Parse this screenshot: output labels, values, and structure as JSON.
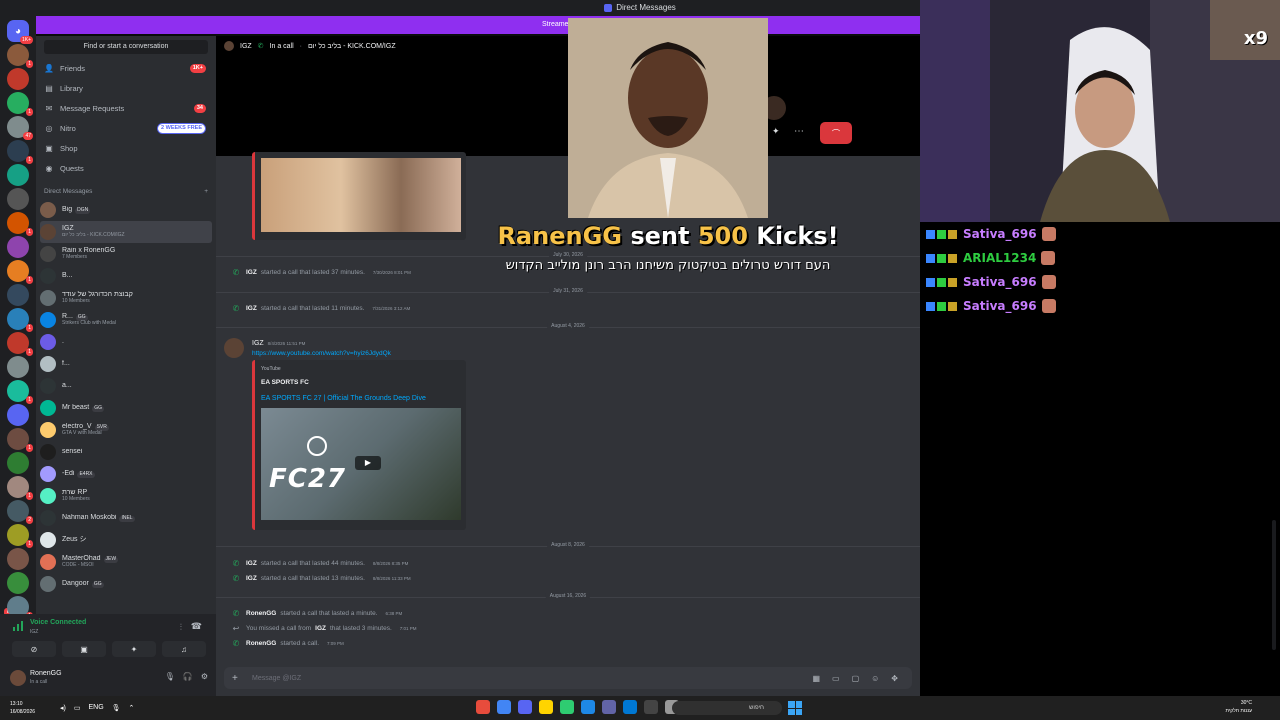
{
  "window": {
    "title": "Direct Messages"
  },
  "stream_banner": "Streame",
  "rail": {
    "new_label": "NEW",
    "servers": [
      {
        "color": "#5865f2",
        "badge": "1K+"
      },
      {
        "color": "#8b5a3c",
        "badge": "1"
      },
      {
        "color": "#c0392b",
        "badge": ""
      },
      {
        "color": "#27ae60",
        "badge": "1"
      },
      {
        "color": "#7f8c8d",
        "badge": "47"
      },
      {
        "color": "#2c3e50",
        "badge": "1"
      },
      {
        "color": "#16a085",
        "badge": ""
      },
      {
        "color": "#555",
        "badge": ""
      },
      {
        "color": "#d35400",
        "badge": "1"
      },
      {
        "color": "#8e44ad",
        "badge": ""
      },
      {
        "color": "#e67e22",
        "badge": "1"
      },
      {
        "color": "#34495e",
        "badge": ""
      },
      {
        "color": "#2980b9",
        "badge": "1"
      },
      {
        "color": "#c0392b",
        "badge": "1"
      },
      {
        "color": "#7f8c8d",
        "badge": ""
      },
      {
        "color": "#1abc9c",
        "badge": "1"
      },
      {
        "color": "#5865f2",
        "badge": ""
      },
      {
        "color": "#6d4c41",
        "badge": "1"
      },
      {
        "color": "#2e7d32",
        "badge": ""
      },
      {
        "color": "#a1887f",
        "badge": "1"
      },
      {
        "color": "#455a64",
        "badge": "2"
      },
      {
        "color": "#9e9d24",
        "badge": "1"
      },
      {
        "color": "#795548",
        "badge": ""
      },
      {
        "color": "#388e3c",
        "badge": ""
      },
      {
        "color": "#607d8b",
        "badge": "1"
      }
    ]
  },
  "sidebar": {
    "search_placeholder": "Find or start a conversation",
    "nav": [
      {
        "label": "Friends",
        "icon": "friends-icon",
        "glyph": "👤",
        "badge": "1K+",
        "promo": false
      },
      {
        "label": "Library",
        "icon": "library-icon",
        "glyph": "▤",
        "badge": "",
        "promo": false
      },
      {
        "label": "Message Requests",
        "icon": "mail-icon",
        "glyph": "✉",
        "badge": "34",
        "promo": false
      },
      {
        "label": "Nitro",
        "icon": "nitro-icon",
        "glyph": "◎",
        "badge": "2 WEEKS FREE",
        "promo": true
      },
      {
        "label": "Shop",
        "icon": "shop-icon",
        "glyph": "▣",
        "badge": "",
        "promo": false
      },
      {
        "label": "Quests",
        "icon": "quests-icon",
        "glyph": "◉",
        "badge": "",
        "promo": false
      }
    ],
    "dm_header": "Direct Messages",
    "dm_add": "+",
    "dms": [
      {
        "name": "Big",
        "tag": "DGN",
        "sub": "",
        "color": "#7a5c4a",
        "active": false
      },
      {
        "name": "IGZ",
        "tag": "",
        "sub": "בליב כל יום - KICK.COM/IGZ",
        "color": "#5b4335",
        "active": true
      },
      {
        "name": "Rain x RonenGG",
        "tag": "",
        "sub": "7 Members",
        "color": "#444",
        "active": false
      },
      {
        "name": "B...",
        "tag": "",
        "sub": "",
        "color": "#2d3436",
        "active": false
      },
      {
        "name": "קבוצת הכדורגל של עודד",
        "tag": "",
        "sub": "10 Members",
        "color": "#636e72",
        "active": false
      },
      {
        "name": "R...",
        "tag": "GG",
        "sub": "Strikers Club with Medal",
        "color": "#0984e3",
        "active": false
      },
      {
        "name": ".",
        "tag": "",
        "sub": "",
        "color": "#6c5ce7",
        "active": false
      },
      {
        "name": "f...",
        "tag": "",
        "sub": "",
        "color": "#b2bec3",
        "active": false
      },
      {
        "name": "a...",
        "tag": "",
        "sub": "",
        "color": "#2d3436",
        "active": false
      },
      {
        "name": "Mr beast",
        "tag": "GG",
        "sub": "",
        "color": "#00b894",
        "active": false
      },
      {
        "name": "electro_V",
        "tag": "SVR",
        "sub": "GTA V with Medal",
        "color": "#fdcb6e",
        "active": false
      },
      {
        "name": "sensei",
        "tag": "",
        "sub": "",
        "color": "#1e1e1e",
        "active": false
      },
      {
        "name": "-Edi",
        "tag": "E4RX",
        "sub": "",
        "color": "#a29bfe",
        "active": false
      },
      {
        "name": "שרת RP",
        "tag": "",
        "sub": "10 Members",
        "color": "#55efc4",
        "active": false
      },
      {
        "name": "Nahman Moskobi",
        "tag": "INEL",
        "sub": "",
        "color": "#2d3436",
        "active": false
      },
      {
        "name": "Zeus シ",
        "tag": "",
        "sub": "",
        "color": "#dfe6e9",
        "active": false
      },
      {
        "name": "MasterOhad",
        "tag": "JEW",
        "sub": "CODE - MSOI",
        "color": "#e17055",
        "active": false
      },
      {
        "name": "Dangoor",
        "tag": "GG",
        "sub": "",
        "color": "#636e72",
        "active": false
      }
    ]
  },
  "voice": {
    "status": "Voice Connected",
    "channel": "IGZ",
    "buttons": [
      {
        "name": "video-off-icon",
        "glyph": "⊘"
      },
      {
        "name": "screen-share-icon",
        "glyph": "▣"
      },
      {
        "name": "activities-icon",
        "glyph": "✦"
      },
      {
        "name": "soundboard-icon",
        "glyph": "♫"
      }
    ]
  },
  "user": {
    "name": "RonenGG",
    "status": "In a call"
  },
  "chat": {
    "header_name": "IGZ",
    "header_call": "In a call",
    "header_status": "בליב כל יום - KICK.COM/IGZ",
    "messages": {
      "sys1": {
        "who": "IGZ",
        "text": "started a call that lasted 37 minutes.",
        "ts": "7/30/2026 8:01 PM"
      },
      "sys2": {
        "who": "IGZ",
        "text": "started a call that lasted 11 minutes.",
        "ts": "7/31/2026 3:12 AM"
      },
      "author": {
        "name": "IGZ",
        "ts": "8/4/2026 11:51 PM"
      },
      "link": "https://www.youtube.com/watch?v=hyiz6JdydQk",
      "embed": {
        "provider": "YouTube",
        "author": "EA SPORTS FC",
        "title": "EA SPORTS FC 27 | Official The Grounds Deep Dive"
      },
      "sys3": {
        "who": "IGZ",
        "text": "started a call that lasted 44 minutes.",
        "ts": "8/8/2026 8:35 PM"
      },
      "sys4": {
        "who": "IGZ",
        "text": "started a call that lasted 13 minutes.",
        "ts": "8/8/2026 11:33 PM"
      },
      "sys5": {
        "who": "RonenGG",
        "text": "started a call that lasted a minute.",
        "ts": "6:38 PM"
      },
      "sys6": {
        "pre": "You missed a call from",
        "who": "IGZ",
        "text": "that lasted 3 minutes.",
        "ts": "7:01 PM"
      },
      "sys7": {
        "who": "RonenGG",
        "text": "started a call.",
        "ts": "7:09 PM"
      }
    },
    "dates": {
      "d1": "July 30, 2026",
      "d2": "July 31, 2026",
      "d3": "August 4, 2026",
      "d4": "August 8, 2026",
      "d5": "August 16, 2026"
    },
    "fc27_logo": "FC27",
    "composer_placeholder": "Message @IGZ"
  },
  "overlay": {
    "alert": {
      "user": "RanenGG",
      "word_sent": "sent",
      "amount": "500",
      "word_kicks": "Kicks!"
    },
    "alert_message": "העם דורש טרולים בטיקטוק משיחנו הרב רונן מולייב הקדוש",
    "chat": [
      {
        "name": "Sativa_696",
        "color": "#c77dff"
      },
      {
        "name": "ARIAL1234",
        "color": "#2ecc40"
      },
      {
        "name": "Sativa_696",
        "color": "#c77dff"
      },
      {
        "name": "Sativa_696",
        "color": "#c77dff"
      }
    ],
    "webcam_tag": "x9"
  },
  "taskbar": {
    "time": "13:10",
    "date": "16/08/2026",
    "lang": "ENG",
    "search_placeholder": "חיפוש",
    "weather_temp": "30°C",
    "weather_desc": "עננות חלקית",
    "apps": [
      "#e74c3c",
      "#4285f4",
      "#5865f2",
      "#ffd400",
      "#2ecc71",
      "#1e88e5",
      "#6264a7",
      "#0078d4",
      "#444",
      "#999"
    ]
  },
  "colors": {
    "accent": "#5865f2",
    "danger": "#da373c",
    "online": "#23a55a",
    "kick_gold": "#f7c248"
  }
}
